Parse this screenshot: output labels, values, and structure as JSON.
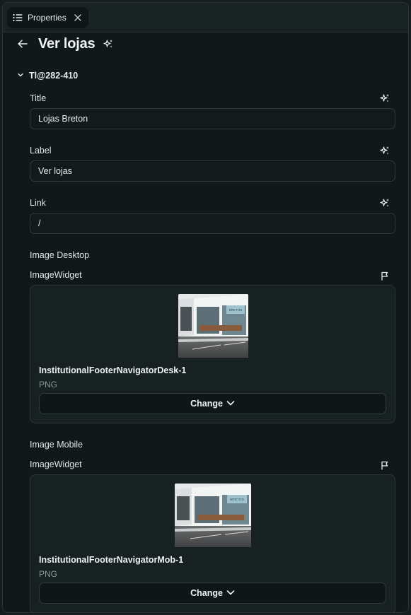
{
  "tab": {
    "label": "Properties"
  },
  "header": {
    "title": "Ver lojas"
  },
  "section": {
    "name": "Tl@282-410"
  },
  "fields": {
    "title": {
      "label": "Title",
      "value": "Lojas Breton"
    },
    "label": {
      "label": "Label",
      "value": "Ver lojas"
    },
    "link": {
      "label": "Link",
      "value": "/"
    }
  },
  "image_desktop": {
    "group_label": "Image Desktop",
    "widget_label": "ImageWidget",
    "file_name": "InstitutionalFooterNavigatorDesk-1",
    "file_type": "PNG",
    "change_label": "Change",
    "storefront_sign": "BRETON"
  },
  "image_mobile": {
    "group_label": "Image Mobile",
    "widget_label": "ImageWidget",
    "file_name": "InstitutionalFooterNavigatorMob-1",
    "file_type": "PNG",
    "change_label": "Change",
    "storefront_sign": "BRETON"
  },
  "icons": {
    "tab": "list-icon",
    "close": "close-icon",
    "back": "arrow-left-icon",
    "ai": "sparkle-icon",
    "collapse": "chevron-down-icon",
    "flag": "flag-icon"
  },
  "colors": {
    "background": "#111819",
    "panel": "#182122",
    "border": "#2f3a3b",
    "text": "#e8eded",
    "muted": "#8a9698"
  }
}
